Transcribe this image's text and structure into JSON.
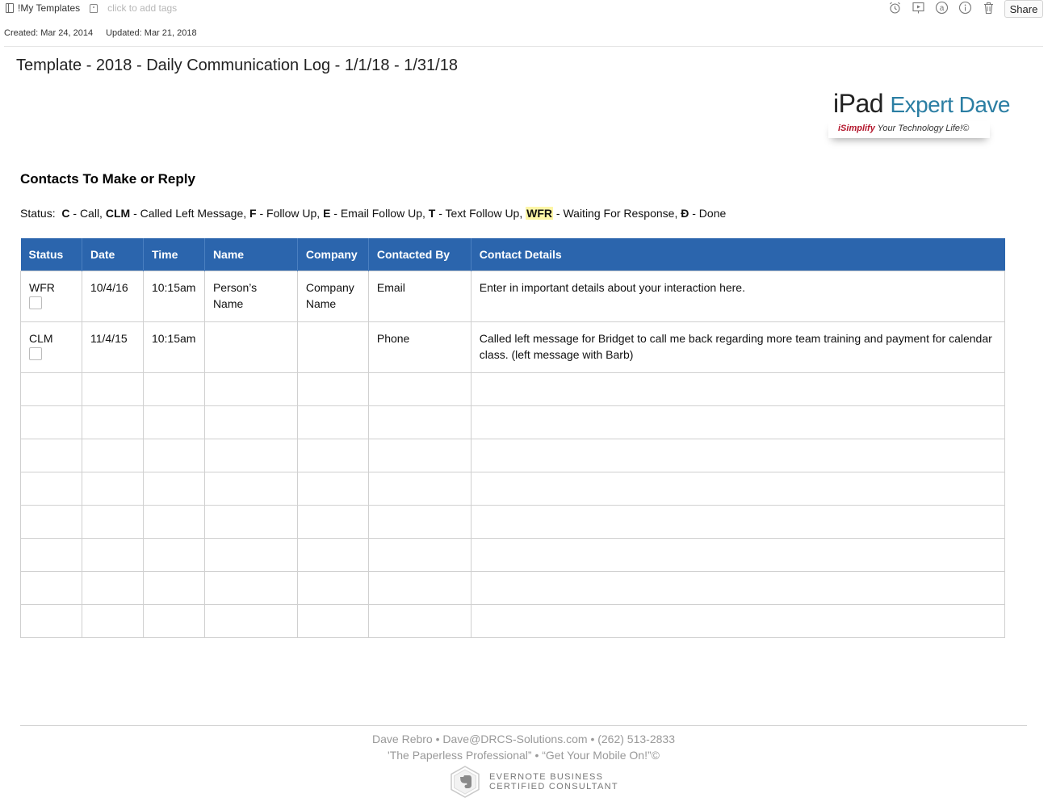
{
  "toolbar": {
    "notebook_name": "!My Templates",
    "tags_placeholder": "click to add tags",
    "icons": [
      "alarm-clock-icon",
      "presentation-icon",
      "at-sign-icon",
      "info-icon",
      "trash-icon"
    ],
    "share_label": "Share"
  },
  "meta": {
    "created": "Created: Mar 24, 2014",
    "updated": "Updated: Mar 21, 2018"
  },
  "note": {
    "title": "Template - 2018 - Daily Communication Log - 1/1/18 - 1/31/18",
    "logo": {
      "ipad": "iPad",
      "expert_dave": "Expert Dave",
      "isimplify": "iSimplify",
      "tagline_rest": "Your Technology Life!©",
      "brand_color": "#2b7ea3",
      "accent_color": "#b3152b"
    },
    "section_heading": "Contacts To Make or Reply",
    "legend": {
      "prefix": "Status:",
      "c": "C",
      "c_text": "- Call,",
      "clm": "CLM",
      "clm_text": "- Called Left Message,",
      "f": "F",
      "f_text": "- Follow Up,",
      "e": "E",
      "e_text": "- Email Follow Up,",
      "t": "T",
      "t_text": "- Text Follow Up,",
      "wfr": "WFR",
      "wfr_text": "- Waiting For Response,",
      "d": "Đ",
      "d_text": "- Done"
    }
  },
  "table": {
    "header_color": "#2b65ad",
    "columns": [
      "Status",
      "Date",
      "Time",
      "Name",
      "Company",
      "Contacted By",
      "Contact Details"
    ],
    "rows": [
      {
        "status": "WFR",
        "date": "10/4/16",
        "time": "10:15am",
        "name": "Person’s Name",
        "company": "Company Name",
        "contacted_by": "Email",
        "details": "Enter in important details about your interaction here."
      },
      {
        "status": "CLM",
        "date": "11/4/15",
        "time": "10:15am",
        "name": "",
        "company": "",
        "contacted_by": "Phone",
        "details": "Called left message for Bridget to call me back regarding more team training and payment for calendar class. (left message with Barb)"
      }
    ]
  },
  "footer": {
    "line1": "Dave Rebro  •  Dave@DRCS-Solutions.com  •  (262) 513-2833",
    "line2": "'The Paperless Professional”  •  “Get Your Mobile On!”©",
    "badge_line1": "EVERNOTE BUSINESS",
    "badge_line2": "CERTIFIED CONSULTANT"
  }
}
